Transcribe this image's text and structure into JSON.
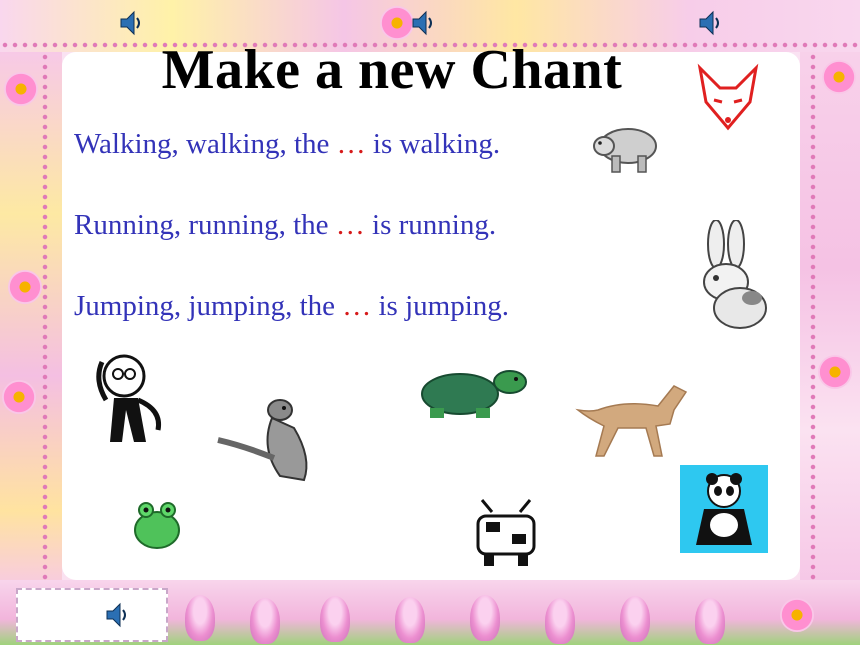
{
  "slide": {
    "title": "Make a new Chant",
    "chant_lines": [
      {
        "start": "Walking, walking, the",
        "blank": "…",
        "end": "is walking."
      },
      {
        "start": "Running, running, the",
        "blank": "…",
        "end": "is running."
      },
      {
        "start": "Jumping, jumping, the",
        "blank": "…",
        "end": "is jumping."
      }
    ]
  },
  "colors": {
    "title": "#000000",
    "chant_text": "#3333b8",
    "blank": "#d61a1a",
    "panel": "#ffffff",
    "border_pink": "#f6d3ea"
  },
  "icons": {
    "audio": "speaker-icon",
    "animals": [
      "fox-icon",
      "polar-bear-icon",
      "rabbit-icon",
      "monkey-icon",
      "kangaroo-icon",
      "turtle-icon",
      "horse-icon",
      "frog-icon",
      "cow-icon",
      "panda-icon"
    ]
  }
}
